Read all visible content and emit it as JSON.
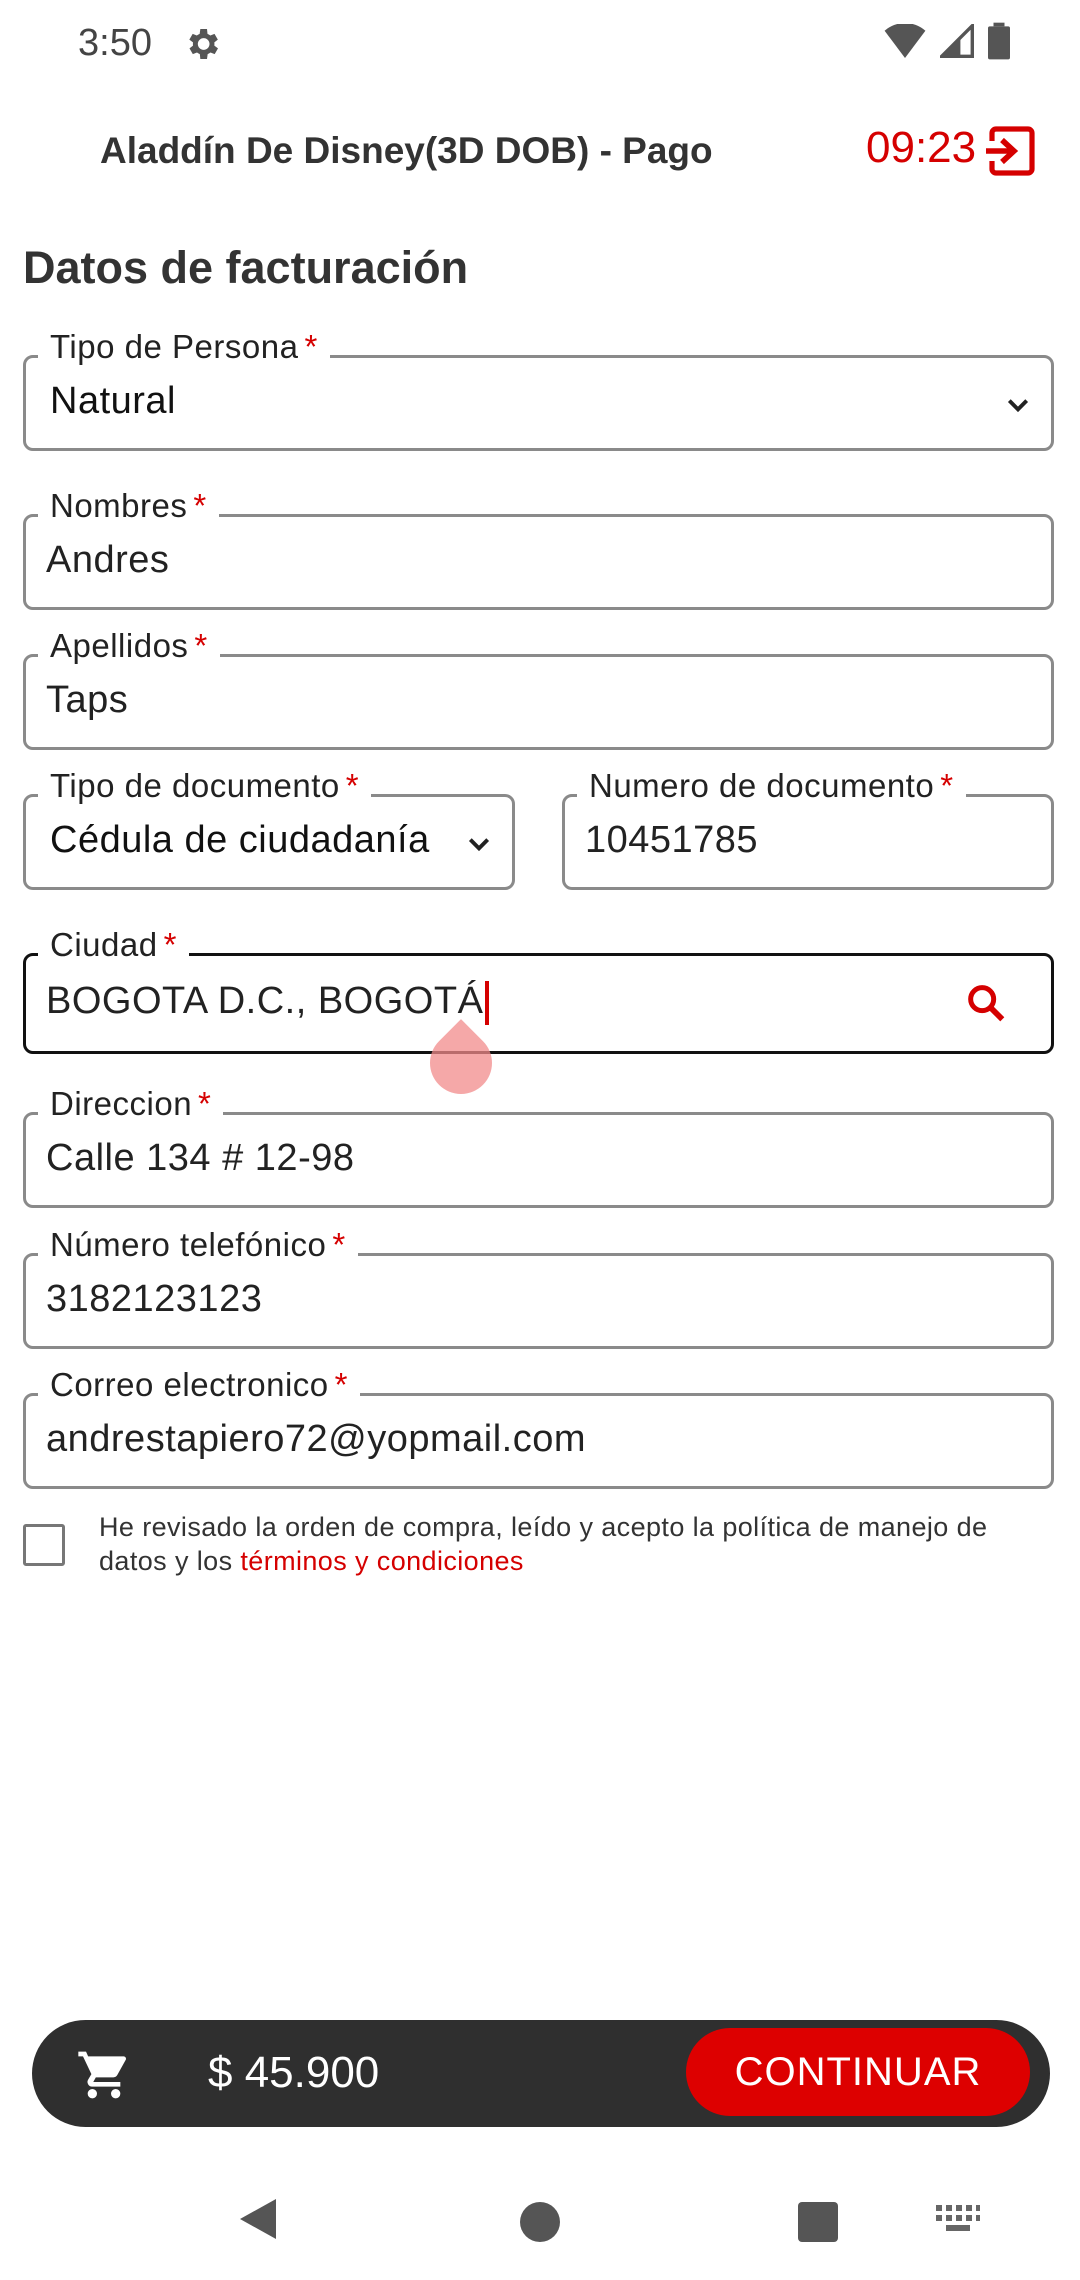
{
  "status_bar": {
    "time": "3:50"
  },
  "header": {
    "title": "Aladdín De Disney(3D DOB) - Pago",
    "timer": "09:23"
  },
  "section_title": "Datos de facturación",
  "form": {
    "tipo_persona": {
      "label": "Tipo de Persona",
      "value": "Natural"
    },
    "nombres": {
      "label": "Nombres",
      "value": "Andres"
    },
    "apellidos": {
      "label": "Apellidos",
      "value": "Taps"
    },
    "tipo_documento": {
      "label": "Tipo de documento",
      "value": "Cédula de ciudadanía"
    },
    "numero_documento": {
      "label": "Numero de documento",
      "value": "10451785"
    },
    "ciudad": {
      "label": "Ciudad",
      "value": "BOGOTA D.C., BOGOTÁ"
    },
    "direccion": {
      "label": "Direccion",
      "value": "Calle 134 # 12-98"
    },
    "telefono": {
      "label": "Número telefónico",
      "value": "3182123123"
    },
    "correo": {
      "label": "Correo electronico",
      "value": "andrestapiero72@yopmail.com"
    },
    "required_mark": "*"
  },
  "terms": {
    "text": "He revisado la orden de compra, leído y acepto la política de manejo de datos y los ",
    "link": "términos y condiciones",
    "checked": false
  },
  "cart": {
    "total": "$ 45.900",
    "continue_label": "CONTINUAR"
  },
  "colors": {
    "accent": "#d50000",
    "bar_bg": "#2f2f2f"
  }
}
